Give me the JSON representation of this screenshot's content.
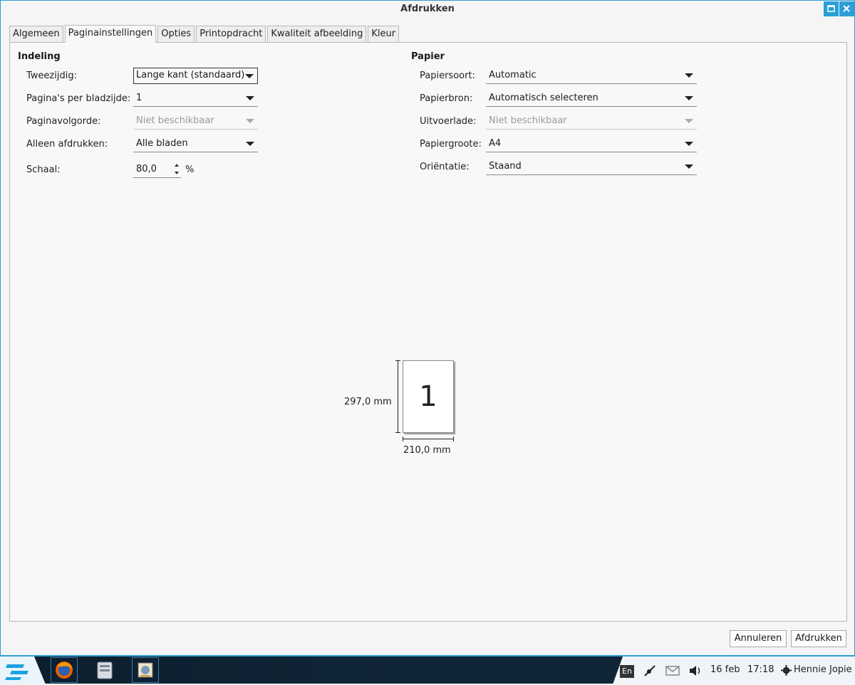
{
  "window": {
    "title": "Afdrukken"
  },
  "tabs": [
    "Algemeen",
    "Paginainstellingen",
    "Opties",
    "Printopdracht",
    "Kwaliteit afbeelding",
    "Kleur"
  ],
  "indeling": {
    "title": "Indeling",
    "tweezijdig": {
      "label": "Tweezijdig:",
      "value": "Lange kant (standaard)"
    },
    "paginas_per_blad": {
      "label": "Pagina's per bladzijde:",
      "value": "1"
    },
    "paginavolgorde": {
      "label": "Paginavolgorde:",
      "value": "Niet beschikbaar"
    },
    "alleen_afdrukken": {
      "label": "Alleen afdrukken:",
      "value": "Alle bladen"
    },
    "schaal": {
      "label": "Schaal:",
      "value": "80,0",
      "unit": "%"
    }
  },
  "papier": {
    "title": "Papier",
    "papiersoort": {
      "label": "Papiersoort:",
      "value": "Automatic"
    },
    "papierbron": {
      "label": "Papierbron:",
      "value": "Automatisch selecteren"
    },
    "uitvoerlade": {
      "label": "Uitvoerlade:",
      "value": "Niet beschikbaar"
    },
    "papiergroote": {
      "label": "Papiergroote:",
      "value": "A4"
    },
    "orientatie": {
      "label": "Oriëntatie:",
      "value": "Staand"
    }
  },
  "preview": {
    "page_number": "1",
    "height_label": "297,0 mm",
    "width_label": "210,0 mm"
  },
  "buttons": {
    "cancel": "Annuleren",
    "print": "Afdrukken"
  },
  "taskbar": {
    "apps": [
      "firefox-icon",
      "file-manager-icon",
      "printer-app-icon"
    ],
    "language": "En",
    "date": "16 feb",
    "time": "17:18",
    "user": "Hennie Jopie"
  }
}
